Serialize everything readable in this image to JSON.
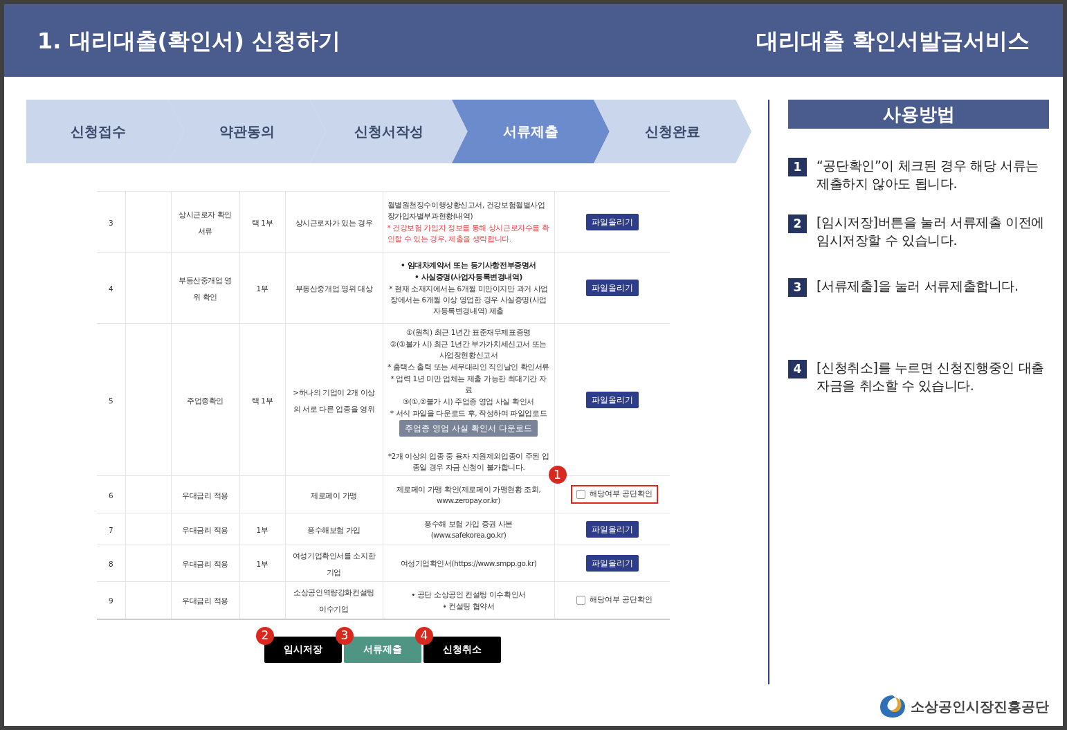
{
  "header": {
    "title": "1. 대리대출(확인서) 신청하기",
    "service": "대리대출 확인서발급서비스"
  },
  "steps": [
    {
      "label": "신청접수",
      "selected": false
    },
    {
      "label": "약관동의",
      "selected": false
    },
    {
      "label": "신청서작성",
      "selected": false
    },
    {
      "label": "서류제출",
      "selected": true
    },
    {
      "label": "신청완료",
      "selected": false
    }
  ],
  "table": {
    "rows": [
      {
        "no": "3",
        "category": "상시근로자 확인서류",
        "copies": "택 1부",
        "target": "상시근로자가 있는 경우",
        "docs": [
          {
            "kind": "paragraph",
            "text": "월별원천징수이행상황신고서, 건강보험월별사업장가입자별부과현황(내역)"
          },
          {
            "kind": "paragraph-note",
            "text": "* 건강보험 가입자 정보를 통해 상시근로자수를 확인할 수 있는 경우, 제출을 생략합니다."
          }
        ],
        "action": {
          "kind": "upload",
          "label": "파일올리기"
        }
      },
      {
        "no": "4",
        "category": "부동산중개업 영위 확인",
        "copies": "1부",
        "target": "부동산중개업 영위 대상",
        "docs": [
          {
            "kind": "bold",
            "text": "• 임대차계약서 또는 등기사항전부증명서"
          },
          {
            "kind": "bold",
            "text": "• 사실증명(사업자등록변경내역)"
          },
          {
            "kind": "text",
            "text": "* 현재 소재지에서는 6개월 미만이지만 과거 사업장에서는 6개월 이상 영업한 경우 사실증명(사업자등록변경내역) 제출"
          }
        ],
        "action": {
          "kind": "upload",
          "label": "파일올리기"
        }
      },
      {
        "no": "5",
        "category": "주업종확인",
        "copies": "택 1부",
        "target": ">하나의 기업이 2개 이상의 서로 다른 업종을 영위",
        "docs": [
          {
            "kind": "text",
            "text": "①(원칙) 최근 1년간 표준재무제표증명"
          },
          {
            "kind": "text",
            "text": "②(①불가 시) 최근 1년간 부가가치세신고서 또는 사업장현황신고서"
          },
          {
            "kind": "text",
            "text": "* 홈택스 출력 또는 세무대리인 직인날인 확인서류"
          },
          {
            "kind": "text",
            "text": "* 업력 1년 미만 업체는 제출 가능한 최대기간 자료"
          },
          {
            "kind": "text",
            "text": "③(①,②불가 시) 주업종 영업 사실 확인서"
          },
          {
            "kind": "text",
            "text": "* 서식 파일을 다운로드 후, 작성하여 파일업로드"
          },
          {
            "kind": "download",
            "text": "주업종 영업 사실 확인서 다운로드"
          },
          {
            "kind": "text",
            "text": "*2개 이상의 업종 중 융자 지원제외업종이 주된 업종일 경우 자금 신청이 불가합니다.",
            "gap": true
          }
        ],
        "action": {
          "kind": "upload",
          "label": "파일올리기"
        }
      },
      {
        "no": "6",
        "category": "우대금리 적용",
        "target": "제로페이 가맹",
        "docs": [
          {
            "kind": "text",
            "text": "제로페이 가맹 확인(제로페이 가맹현황 조회, www.zeropay.or.kr)"
          }
        ],
        "action": {
          "kind": "check",
          "label": "해당여부 공단확인",
          "checked": false,
          "highlighted": true,
          "badge": "1"
        }
      },
      {
        "no": "7",
        "category": "우대금리 적용",
        "copies": "1부",
        "target": "풍수해보험 가입",
        "docs": [
          {
            "kind": "text",
            "text": "풍수해 보험 가입 증권 사본 (www.safekorea.go.kr)"
          }
        ],
        "action": {
          "kind": "upload",
          "label": "파일올리기"
        }
      },
      {
        "no": "8",
        "category": "우대금리 적용",
        "copies": "1부",
        "target": "여성기업확인서를 소지한 기업",
        "docs": [
          {
            "kind": "text",
            "text": "여성기업확인서(https://www.smpp.go.kr)"
          }
        ],
        "action": {
          "kind": "upload",
          "label": "파일올리기"
        }
      },
      {
        "no": "9",
        "category": "우대금리 적용",
        "target": "소상공인역량강화컨설팅 이수기업",
        "docs": [
          {
            "kind": "text",
            "text": "• 공단 소상공인 컨설팅 이수확인서"
          },
          {
            "kind": "text",
            "text": "• 컨설팅 협약서"
          }
        ],
        "action": {
          "kind": "check",
          "label": "해당여부 공단확인",
          "checked": false,
          "highlighted": false
        }
      }
    ]
  },
  "buttons": [
    {
      "label": "임시저장",
      "kind": "dark",
      "badge": "2"
    },
    {
      "label": "서류제출",
      "kind": "green",
      "badge": "3"
    },
    {
      "label": "신청취소",
      "kind": "dark",
      "badge": "4"
    }
  ],
  "guide": {
    "title": "사용방법",
    "items": [
      {
        "number": "1",
        "text": "“공단확인”이 체크된 경우 해당 서류는 제출하지 않아도 됩니다."
      },
      {
        "number": "2",
        "text": "[임시저장]버튼을 눌러 서류제출 이전에 임시저장할 수 있습니다."
      },
      {
        "number": "3",
        "text": "[서류제출]을 눌러 서류제출합니다."
      },
      {
        "number": "4",
        "text": "[신청취소]를 누르면 신청진행중인 대출자금을 취소할 수 있습니다."
      }
    ]
  },
  "logo": {
    "text": "소상공인시장진흥공단"
  }
}
